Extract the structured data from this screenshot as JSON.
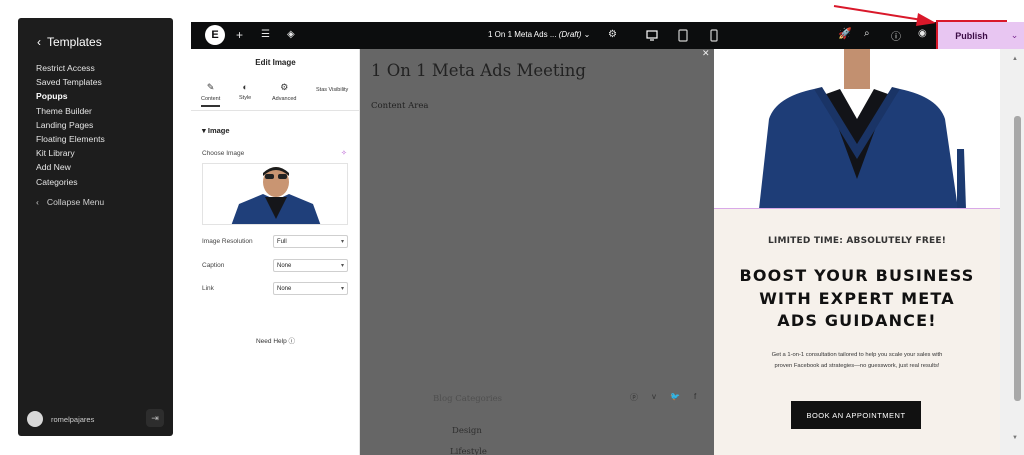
{
  "wp_sidebar": {
    "back_label": "Templates",
    "items": [
      {
        "label": "Restrict Access"
      },
      {
        "label": "Saved Templates"
      },
      {
        "label": "Popups"
      },
      {
        "label": "Theme Builder"
      },
      {
        "label": "Landing Pages"
      },
      {
        "label": "Floating Elements"
      },
      {
        "label": "Kit Library"
      },
      {
        "label": "Add New"
      },
      {
        "label": "Categories"
      }
    ],
    "active_item": "Popups",
    "collapse_label": "Collapse Menu",
    "username": "romelpajares"
  },
  "topbar": {
    "logo_text": "E",
    "doc_title": "1 On 1 Meta Ads ...",
    "doc_status": "(Draft)",
    "publish_label": "Publish"
  },
  "panel": {
    "title": "Edit Image",
    "tabs": [
      {
        "label": "Content"
      },
      {
        "label": "Style"
      },
      {
        "label": "Advanced"
      },
      {
        "label": "Stas Visibility"
      }
    ],
    "section": "Image",
    "choose_image_label": "Choose Image",
    "resolution_label": "Image Resolution",
    "resolution_value": "Full",
    "caption_label": "Caption",
    "caption_value": "None",
    "link_label": "Link",
    "link_value": "None",
    "need_help": "Need Help"
  },
  "canvas": {
    "page_title": "1 On 1 Meta Ads Meeting",
    "content_area": "Content Area",
    "blog_categories": "Blog Categories",
    "design": "Design",
    "lifestyle": "Lifestyle"
  },
  "popup": {
    "kicker": "LIMITED TIME: ABSOLUTELY FREE!",
    "headline_line1": "BOOST YOUR BUSINESS",
    "headline_line2": "WITH EXPERT META",
    "headline_line3": "ADS GUIDANCE!",
    "desc_line1": "Get a 1-on-1 consultation tailored to help you scale your sales with",
    "desc_line2": "proven Facebook ad strategies—no guesswork, just real results!",
    "cta": "BOOK AN APPOINTMENT"
  },
  "colors": {
    "accent_publish": "#e8c6f2",
    "annotation_red": "#d9182a"
  }
}
